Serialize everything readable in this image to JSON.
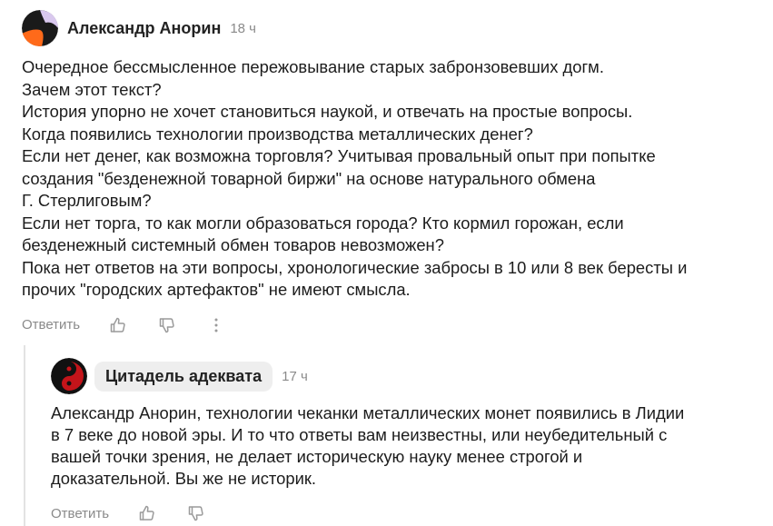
{
  "comments": [
    {
      "author": "Александр Анорин",
      "time": "18 ч",
      "lines": [
        "Очередное бессмысленное пережовывание старых забронзовевших догм.",
        "Зачем этот текст?",
        "История упорно не хочет становиться наукой, и отвечать на простые вопросы.",
        "Когда появились технологии производства металлических денег?",
        "Если нет денег, как возможна торговля? Учитывая провальный опыт при попытке",
        "создания \"безденежной товарной биржи\" на основе натурального обмена",
        "Г. Стерлиговым?",
        "Если нет торга, то как могли образоваться города? Кто кормил горожан, если",
        "безденежный системный обмен товаров невозможен?",
        "Пока нет ответов на эти вопросы, хронологические забросы в 10 или 8 век бересты и",
        "прочих \"городских артефактов\" не имеют смысла."
      ],
      "reply_label": "Ответить",
      "icons": {
        "like": "thumbs-up-icon",
        "dislike": "thumbs-down-icon",
        "more": "more-vertical-icon"
      }
    },
    {
      "author": "Цитадель адеквата",
      "time": "17 ч",
      "lines": [
        "Александр Анорин, технологии чеканки металлических монет появились в Лидии",
        "в 7 веке до новой эры. И то что ответы вам неизвестны, или неубедительный с",
        "вашей точки зрения, не делает историческую науку менее строгой и",
        "доказательной. Вы же не историк."
      ],
      "reply_label": "Ответить",
      "icons": {
        "like": "thumbs-up-icon",
        "dislike": "thumbs-down-icon"
      }
    }
  ],
  "colors": {
    "text": "#1c1c1c",
    "muted": "#8a8a8a",
    "author_pill_bg": "#eeeeee",
    "thread_line": "#e3e3e3"
  }
}
